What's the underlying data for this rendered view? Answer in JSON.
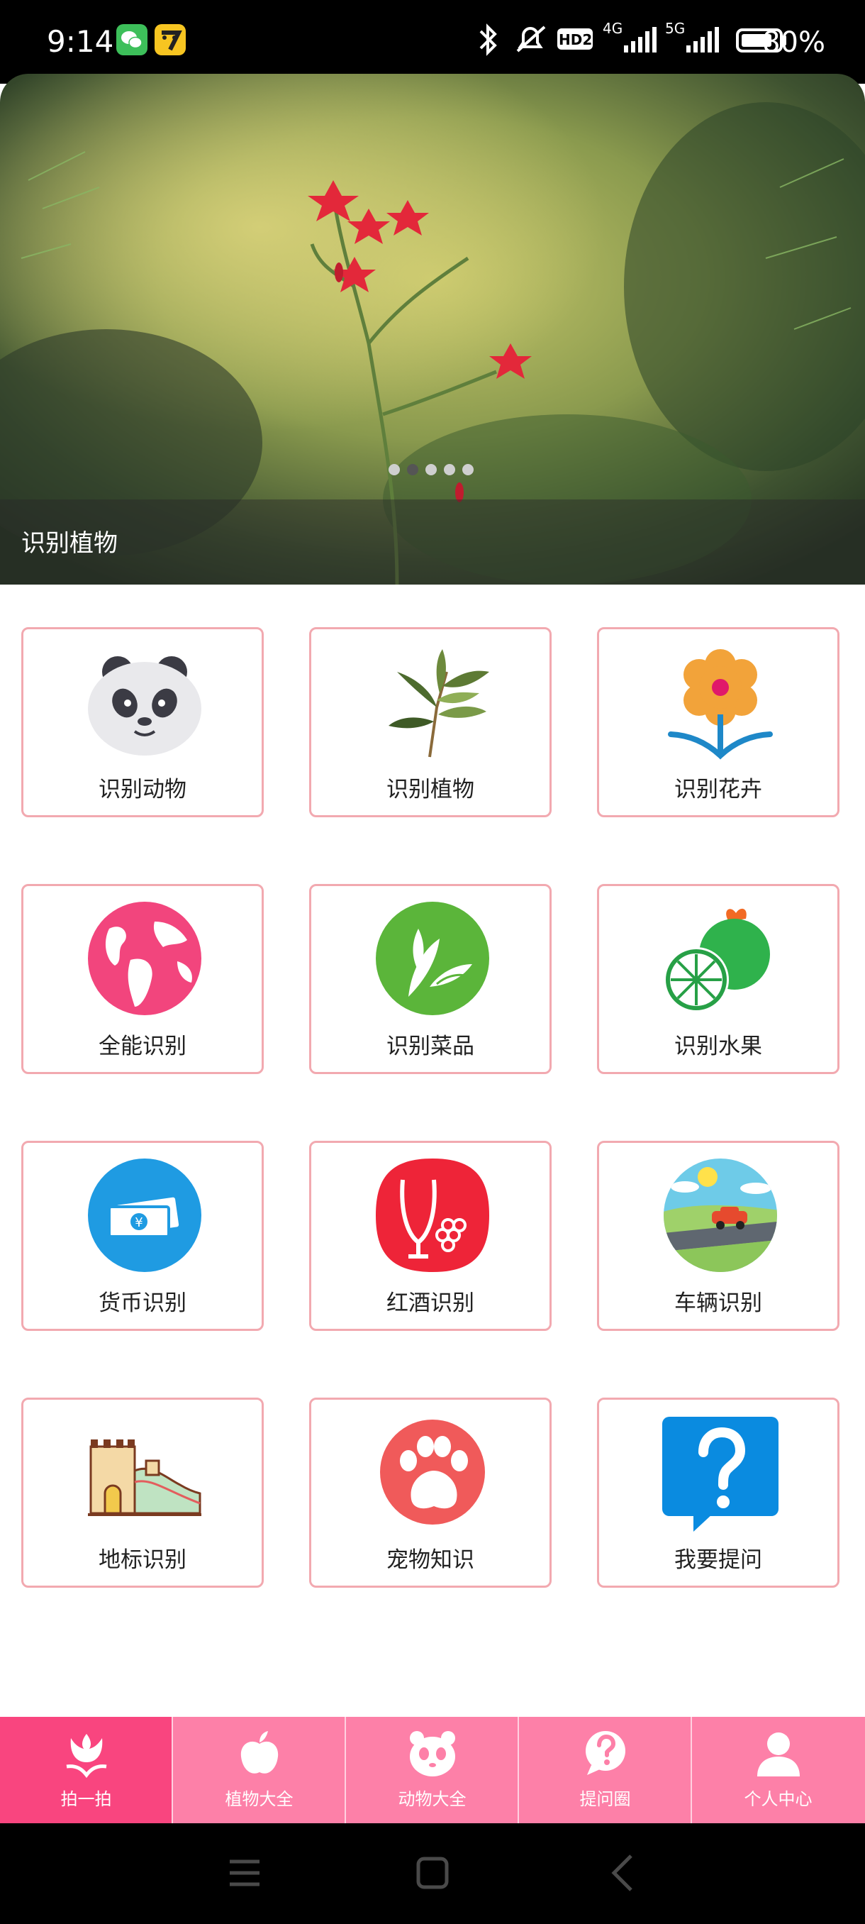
{
  "status_bar": {
    "time": "9:14",
    "hd_label": "HD2",
    "net1": "4G",
    "net2": "5G",
    "battery": "80%",
    "icons": [
      "wechat-icon",
      "app-icon",
      "bluetooth-icon",
      "mute-icon",
      "hd-icon",
      "signal-4g-icon",
      "signal-5g-icon",
      "battery-icon"
    ]
  },
  "banner": {
    "caption": "识别植物",
    "dot_count": 5,
    "active_dot": 1
  },
  "grid": {
    "items": [
      {
        "label": "识别动物",
        "icon": "panda-icon"
      },
      {
        "label": "识别植物",
        "icon": "leaf-branch-icon"
      },
      {
        "label": "识别花卉",
        "icon": "flower-icon"
      },
      {
        "label": "全能识别",
        "icon": "globe-icon"
      },
      {
        "label": "识别菜品",
        "icon": "dish-leaves-icon"
      },
      {
        "label": "识别水果",
        "icon": "fruit-icon"
      },
      {
        "label": "货币识别",
        "icon": "currency-icon"
      },
      {
        "label": "红酒识别",
        "icon": "wine-icon"
      },
      {
        "label": "车辆识别",
        "icon": "car-icon"
      },
      {
        "label": "地标识别",
        "icon": "great-wall-icon"
      },
      {
        "label": "宠物知识",
        "icon": "paw-icon"
      },
      {
        "label": "我要提问",
        "icon": "question-bubble-icon"
      }
    ]
  },
  "bottom_nav": {
    "items": [
      {
        "label": "拍一拍",
        "icon": "tulip-icon",
        "active": true
      },
      {
        "label": "植物大全",
        "icon": "apple-icon",
        "active": false
      },
      {
        "label": "动物大全",
        "icon": "panda-face-icon",
        "active": false
      },
      {
        "label": "提问圈",
        "icon": "question-chat-icon",
        "active": false
      },
      {
        "label": "个人中心",
        "icon": "person-icon",
        "active": false
      }
    ],
    "active_color": "#f9457f",
    "color": "#fd80a8"
  },
  "system_nav": {
    "icons": [
      "menu-icon",
      "home-icon",
      "back-icon"
    ]
  }
}
